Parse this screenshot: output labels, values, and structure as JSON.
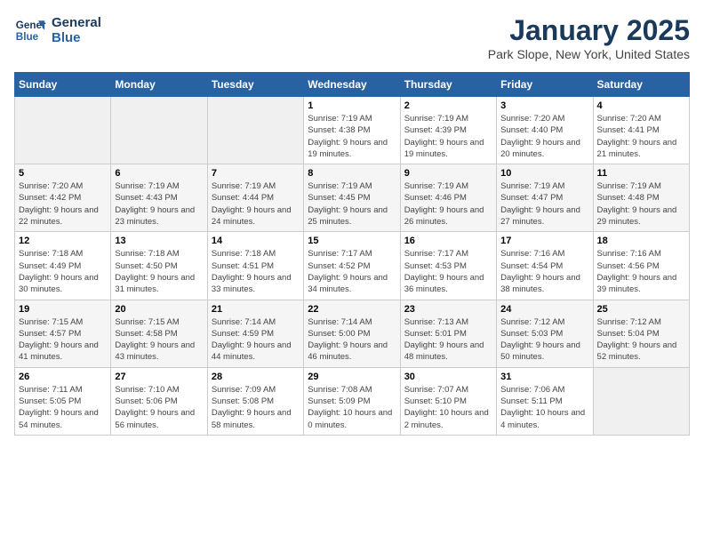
{
  "logo": {
    "line1": "General",
    "line2": "Blue"
  },
  "title": "January 2025",
  "subtitle": "Park Slope, New York, United States",
  "weekdays": [
    "Sunday",
    "Monday",
    "Tuesday",
    "Wednesday",
    "Thursday",
    "Friday",
    "Saturday"
  ],
  "weeks": [
    [
      {
        "day": "",
        "sunrise": "",
        "sunset": "",
        "daylight": "",
        "empty": true
      },
      {
        "day": "",
        "sunrise": "",
        "sunset": "",
        "daylight": "",
        "empty": true
      },
      {
        "day": "",
        "sunrise": "",
        "sunset": "",
        "daylight": "",
        "empty": true
      },
      {
        "day": "1",
        "sunrise": "Sunrise: 7:19 AM",
        "sunset": "Sunset: 4:38 PM",
        "daylight": "Daylight: 9 hours and 19 minutes."
      },
      {
        "day": "2",
        "sunrise": "Sunrise: 7:19 AM",
        "sunset": "Sunset: 4:39 PM",
        "daylight": "Daylight: 9 hours and 19 minutes."
      },
      {
        "day": "3",
        "sunrise": "Sunrise: 7:20 AM",
        "sunset": "Sunset: 4:40 PM",
        "daylight": "Daylight: 9 hours and 20 minutes."
      },
      {
        "day": "4",
        "sunrise": "Sunrise: 7:20 AM",
        "sunset": "Sunset: 4:41 PM",
        "daylight": "Daylight: 9 hours and 21 minutes."
      }
    ],
    [
      {
        "day": "5",
        "sunrise": "Sunrise: 7:20 AM",
        "sunset": "Sunset: 4:42 PM",
        "daylight": "Daylight: 9 hours and 22 minutes."
      },
      {
        "day": "6",
        "sunrise": "Sunrise: 7:19 AM",
        "sunset": "Sunset: 4:43 PM",
        "daylight": "Daylight: 9 hours and 23 minutes."
      },
      {
        "day": "7",
        "sunrise": "Sunrise: 7:19 AM",
        "sunset": "Sunset: 4:44 PM",
        "daylight": "Daylight: 9 hours and 24 minutes."
      },
      {
        "day": "8",
        "sunrise": "Sunrise: 7:19 AM",
        "sunset": "Sunset: 4:45 PM",
        "daylight": "Daylight: 9 hours and 25 minutes."
      },
      {
        "day": "9",
        "sunrise": "Sunrise: 7:19 AM",
        "sunset": "Sunset: 4:46 PM",
        "daylight": "Daylight: 9 hours and 26 minutes."
      },
      {
        "day": "10",
        "sunrise": "Sunrise: 7:19 AM",
        "sunset": "Sunset: 4:47 PM",
        "daylight": "Daylight: 9 hours and 27 minutes."
      },
      {
        "day": "11",
        "sunrise": "Sunrise: 7:19 AM",
        "sunset": "Sunset: 4:48 PM",
        "daylight": "Daylight: 9 hours and 29 minutes."
      }
    ],
    [
      {
        "day": "12",
        "sunrise": "Sunrise: 7:18 AM",
        "sunset": "Sunset: 4:49 PM",
        "daylight": "Daylight: 9 hours and 30 minutes."
      },
      {
        "day": "13",
        "sunrise": "Sunrise: 7:18 AM",
        "sunset": "Sunset: 4:50 PM",
        "daylight": "Daylight: 9 hours and 31 minutes."
      },
      {
        "day": "14",
        "sunrise": "Sunrise: 7:18 AM",
        "sunset": "Sunset: 4:51 PM",
        "daylight": "Daylight: 9 hours and 33 minutes."
      },
      {
        "day": "15",
        "sunrise": "Sunrise: 7:17 AM",
        "sunset": "Sunset: 4:52 PM",
        "daylight": "Daylight: 9 hours and 34 minutes."
      },
      {
        "day": "16",
        "sunrise": "Sunrise: 7:17 AM",
        "sunset": "Sunset: 4:53 PM",
        "daylight": "Daylight: 9 hours and 36 minutes."
      },
      {
        "day": "17",
        "sunrise": "Sunrise: 7:16 AM",
        "sunset": "Sunset: 4:54 PM",
        "daylight": "Daylight: 9 hours and 38 minutes."
      },
      {
        "day": "18",
        "sunrise": "Sunrise: 7:16 AM",
        "sunset": "Sunset: 4:56 PM",
        "daylight": "Daylight: 9 hours and 39 minutes."
      }
    ],
    [
      {
        "day": "19",
        "sunrise": "Sunrise: 7:15 AM",
        "sunset": "Sunset: 4:57 PM",
        "daylight": "Daylight: 9 hours and 41 minutes."
      },
      {
        "day": "20",
        "sunrise": "Sunrise: 7:15 AM",
        "sunset": "Sunset: 4:58 PM",
        "daylight": "Daylight: 9 hours and 43 minutes."
      },
      {
        "day": "21",
        "sunrise": "Sunrise: 7:14 AM",
        "sunset": "Sunset: 4:59 PM",
        "daylight": "Daylight: 9 hours and 44 minutes."
      },
      {
        "day": "22",
        "sunrise": "Sunrise: 7:14 AM",
        "sunset": "Sunset: 5:00 PM",
        "daylight": "Daylight: 9 hours and 46 minutes."
      },
      {
        "day": "23",
        "sunrise": "Sunrise: 7:13 AM",
        "sunset": "Sunset: 5:01 PM",
        "daylight": "Daylight: 9 hours and 48 minutes."
      },
      {
        "day": "24",
        "sunrise": "Sunrise: 7:12 AM",
        "sunset": "Sunset: 5:03 PM",
        "daylight": "Daylight: 9 hours and 50 minutes."
      },
      {
        "day": "25",
        "sunrise": "Sunrise: 7:12 AM",
        "sunset": "Sunset: 5:04 PM",
        "daylight": "Daylight: 9 hours and 52 minutes."
      }
    ],
    [
      {
        "day": "26",
        "sunrise": "Sunrise: 7:11 AM",
        "sunset": "Sunset: 5:05 PM",
        "daylight": "Daylight: 9 hours and 54 minutes."
      },
      {
        "day": "27",
        "sunrise": "Sunrise: 7:10 AM",
        "sunset": "Sunset: 5:06 PM",
        "daylight": "Daylight: 9 hours and 56 minutes."
      },
      {
        "day": "28",
        "sunrise": "Sunrise: 7:09 AM",
        "sunset": "Sunset: 5:08 PM",
        "daylight": "Daylight: 9 hours and 58 minutes."
      },
      {
        "day": "29",
        "sunrise": "Sunrise: 7:08 AM",
        "sunset": "Sunset: 5:09 PM",
        "daylight": "Daylight: 10 hours and 0 minutes."
      },
      {
        "day": "30",
        "sunrise": "Sunrise: 7:07 AM",
        "sunset": "Sunset: 5:10 PM",
        "daylight": "Daylight: 10 hours and 2 minutes."
      },
      {
        "day": "31",
        "sunrise": "Sunrise: 7:06 AM",
        "sunset": "Sunset: 5:11 PM",
        "daylight": "Daylight: 10 hours and 4 minutes."
      },
      {
        "day": "",
        "sunrise": "",
        "sunset": "",
        "daylight": "",
        "empty": true
      }
    ]
  ]
}
